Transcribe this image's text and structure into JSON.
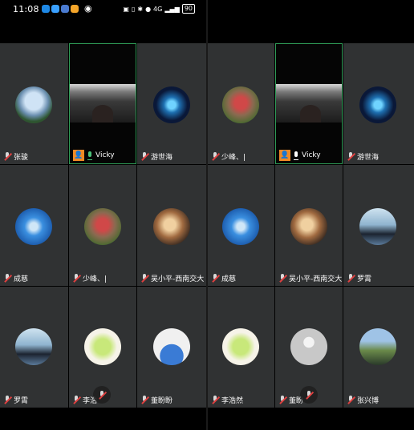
{
  "status": {
    "time": "11:08",
    "battery": "90",
    "signal": "4G"
  },
  "left": {
    "tiles": [
      {
        "name": "张骏"
      },
      {
        "name": "Vicky"
      },
      {
        "name": "游世海"
      },
      {
        "name": "成慈"
      },
      {
        "name": "少峰、|"
      },
      {
        "name": "吴小平-西南交大"
      },
      {
        "name": "罗霄"
      },
      {
        "name": "李浩然"
      },
      {
        "name": "董盼盼"
      }
    ]
  },
  "right": {
    "tiles": [
      {
        "name": "少峰、|"
      },
      {
        "name": "Vicky"
      },
      {
        "name": "游世海"
      },
      {
        "name": "成慈"
      },
      {
        "name": "吴小平-西南交大"
      },
      {
        "name": "罗霄"
      },
      {
        "name": "李浩然"
      },
      {
        "name": "董盼盼"
      },
      {
        "name": "张兴博"
      }
    ]
  },
  "labels_shown": {
    "left_bottom_middle": "李浩",
    "left_bottom_right": "董盼盼",
    "right_bottom_middle": "董盼"
  }
}
